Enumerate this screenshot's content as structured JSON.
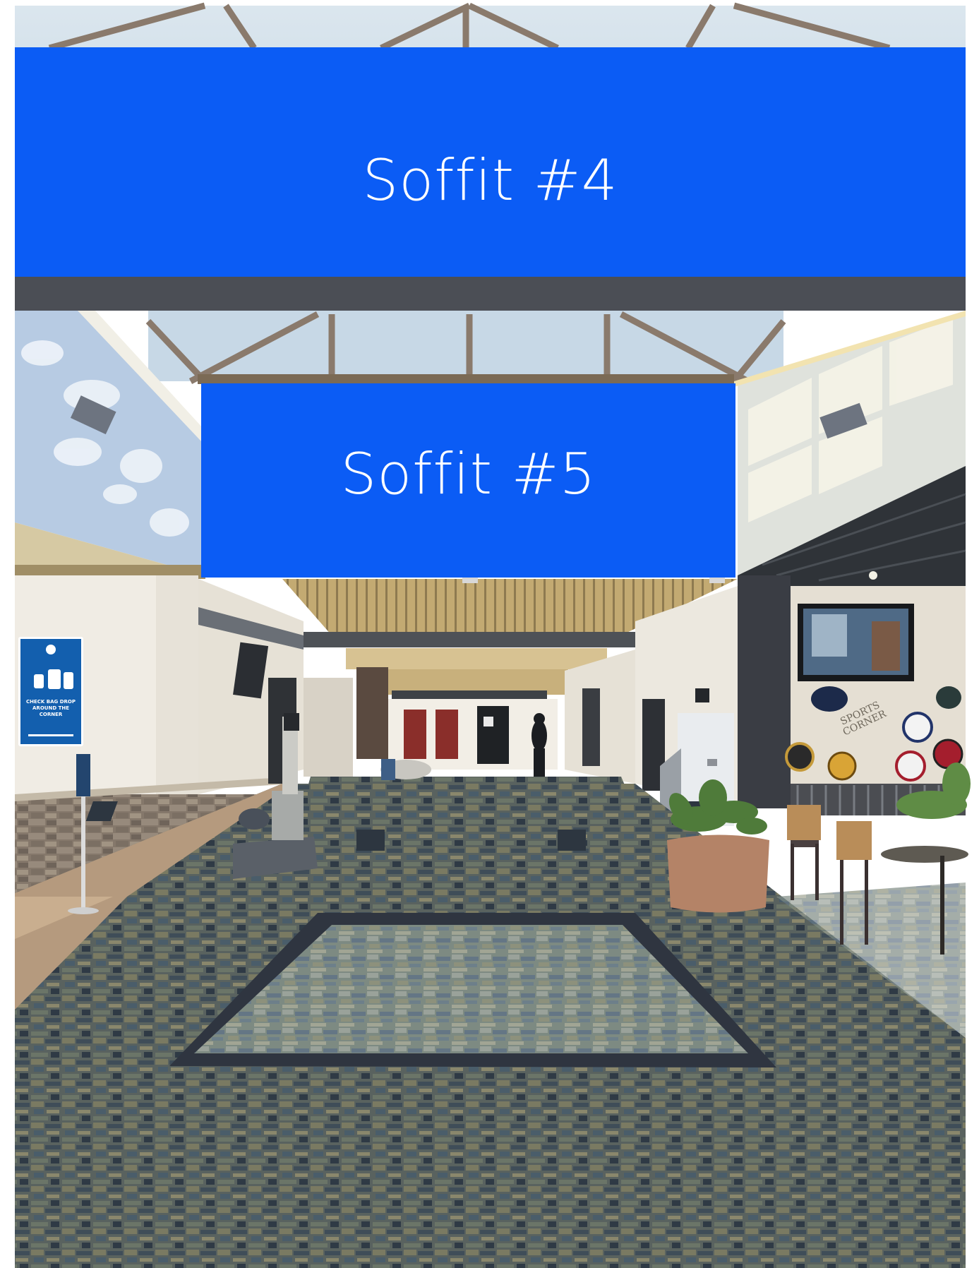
{
  "soffits": {
    "top": {
      "label": "Soffit #4"
    },
    "middle": {
      "label": "Soffit #5"
    }
  },
  "colors": {
    "soffit_blue": "#0b5cf5",
    "soffit_text": "#ffffff"
  },
  "scene": {
    "check_bag_sign": "CHECK BAG DROP AROUND THE CORNER",
    "wall_sign": "SPORTS CORNER"
  }
}
